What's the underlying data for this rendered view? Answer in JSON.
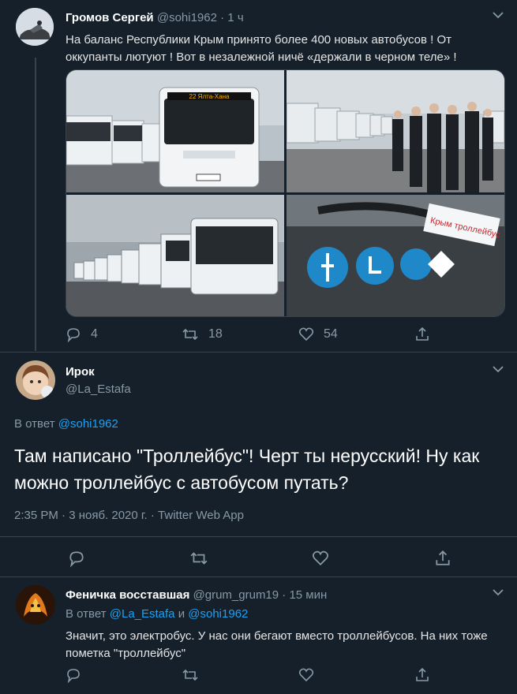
{
  "tweet1": {
    "author": "Громов Сергей",
    "handle": "@sohi1962",
    "time": "· 1 ч",
    "text": "На баланс Республики Крым принято более 400 новых автобусов ! От оккупанты лютуют ! Вот в незалежной ничё «держали в черном теле» !",
    "bus_route": "22 Ялта-Хана",
    "sticker_text": "Крым троллейбус",
    "replies": "4",
    "retweets": "18",
    "likes": "54"
  },
  "tweet2": {
    "author": "Ирок",
    "handle": "@La_Estafa",
    "reply_prefix": "В ответ",
    "reply_to": "@sohi1962",
    "text": "Там написано \"Троллейбус\"! Черт ты нерусский! Ну как можно троллейбус с автобусом путать?",
    "meta": "2:35 PM · 3 нояб. 2020 г. · Twitter Web App"
  },
  "tweet3": {
    "author": "Феничка восставшая",
    "handle": "@grum_grum19",
    "time": "· 15 мин",
    "reply_prefix": "В ответ",
    "reply_to_1": "@La_Estafa",
    "reply_and": "и",
    "reply_to_2": "@sohi1962",
    "text": "Значит, это электробус. У нас они бегают вместо троллейбусов. На них тоже пометка \"троллейбус\""
  },
  "colors": {
    "background": "#15202b",
    "accent": "#1da1f2",
    "muted": "#8899a6",
    "divider": "#38444d"
  }
}
